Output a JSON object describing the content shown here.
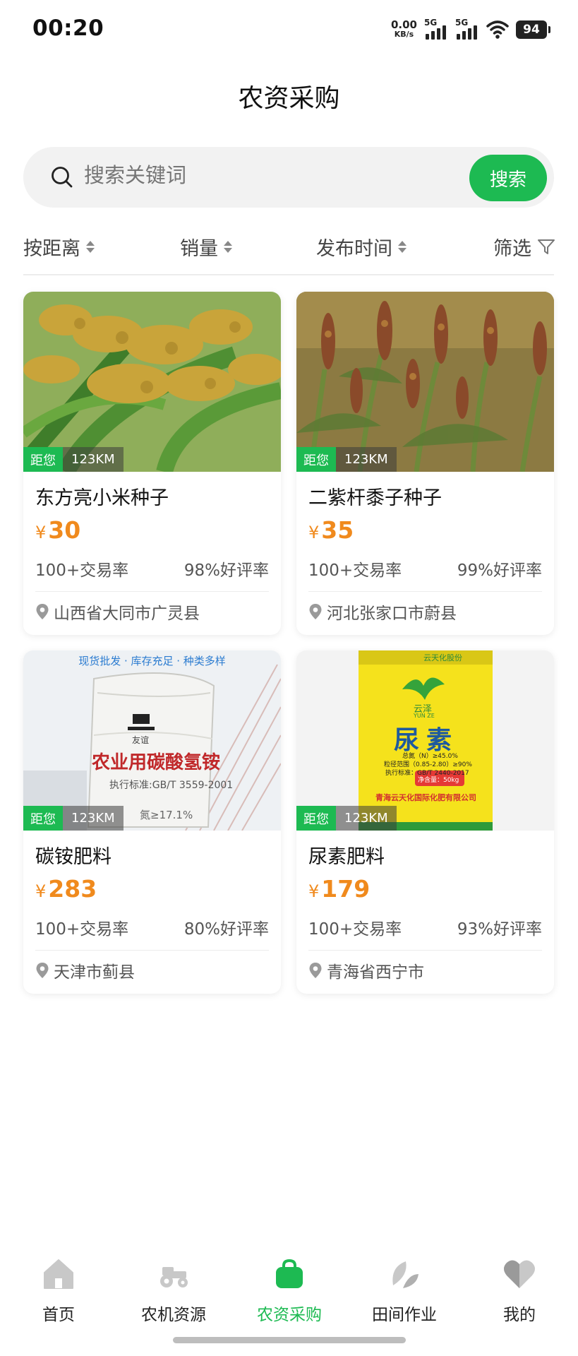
{
  "status_bar": {
    "time": "00:20",
    "net_speed": "0.00",
    "net_unit": "KB/s",
    "signal_1": "5G",
    "signal_2": "5G",
    "battery": "94"
  },
  "header": {
    "title": "农资采购"
  },
  "search": {
    "placeholder": "搜索关键词",
    "button_label": "搜索"
  },
  "filters": [
    {
      "label": "按距离",
      "icon": "sort-arrows-icon"
    },
    {
      "label": "销量",
      "icon": "sort-arrows-icon"
    },
    {
      "label": "发布时间",
      "icon": "sort-arrows-icon"
    },
    {
      "label": "筛选",
      "icon": "funnel-icon"
    }
  ],
  "products": [
    {
      "name": "东方亮小米种子",
      "currency": "¥",
      "price": "30",
      "distance_tag": "距您",
      "distance": "123KM",
      "deals": "100+交易率",
      "rating": "98%好评率",
      "location": "山西省大同市广灵县"
    },
    {
      "name": "二紫杆黍子种子",
      "currency": "¥",
      "price": "35",
      "distance_tag": "距您",
      "distance": "123KM",
      "deals": "100+交易率",
      "rating": "99%好评率",
      "location": "河北张家口市蔚县"
    },
    {
      "name": "碳铵肥料",
      "currency": "¥",
      "price": "283",
      "distance_tag": "距您",
      "distance": "123KM",
      "deals": "100+交易率",
      "rating": "80%好评率",
      "location": "天津市蓟县",
      "image_text": {
        "banner": "现货批发 · 库存充足 · 种类多样",
        "brand": "友谊",
        "bag_title": "农业用碳酸氢铵",
        "standard": "执行标准:GB/T 3559-2001",
        "nitrogen": "氮≥17.1%"
      }
    },
    {
      "name": "尿素肥料",
      "currency": "¥",
      "price": "179",
      "distance_tag": "距您",
      "distance": "123KM",
      "deals": "100+交易率",
      "rating": "93%好评率",
      "location": "青海省西宁市",
      "image_text": {
        "brand": "云泽",
        "brand_en": "YUN ZE",
        "company_top": "云天化股份",
        "bag_title": "尿素",
        "nitrogen": "总氮（N）≥45.0%",
        "granule": "粒径范围（0.85-2.80）≥90%",
        "standard": "执行标准：GB/T 2440-2017",
        "net_weight": "净含量：50kg",
        "company": "青海云天化国际化肥有限公司"
      }
    }
  ],
  "bottom_nav": [
    {
      "label": "首页",
      "icon": "home-icon",
      "active": false
    },
    {
      "label": "农机资源",
      "icon": "tractor-icon",
      "active": false
    },
    {
      "label": "农资采购",
      "icon": "shopping-bag-icon",
      "active": true
    },
    {
      "label": "田间作业",
      "icon": "leaf-icon",
      "active": false
    },
    {
      "label": "我的",
      "icon": "heart-icon",
      "active": false
    }
  ],
  "colors": {
    "accent": "#1dba52",
    "price": "#f08a1d",
    "inactive_icon": "#c8c8c8"
  }
}
